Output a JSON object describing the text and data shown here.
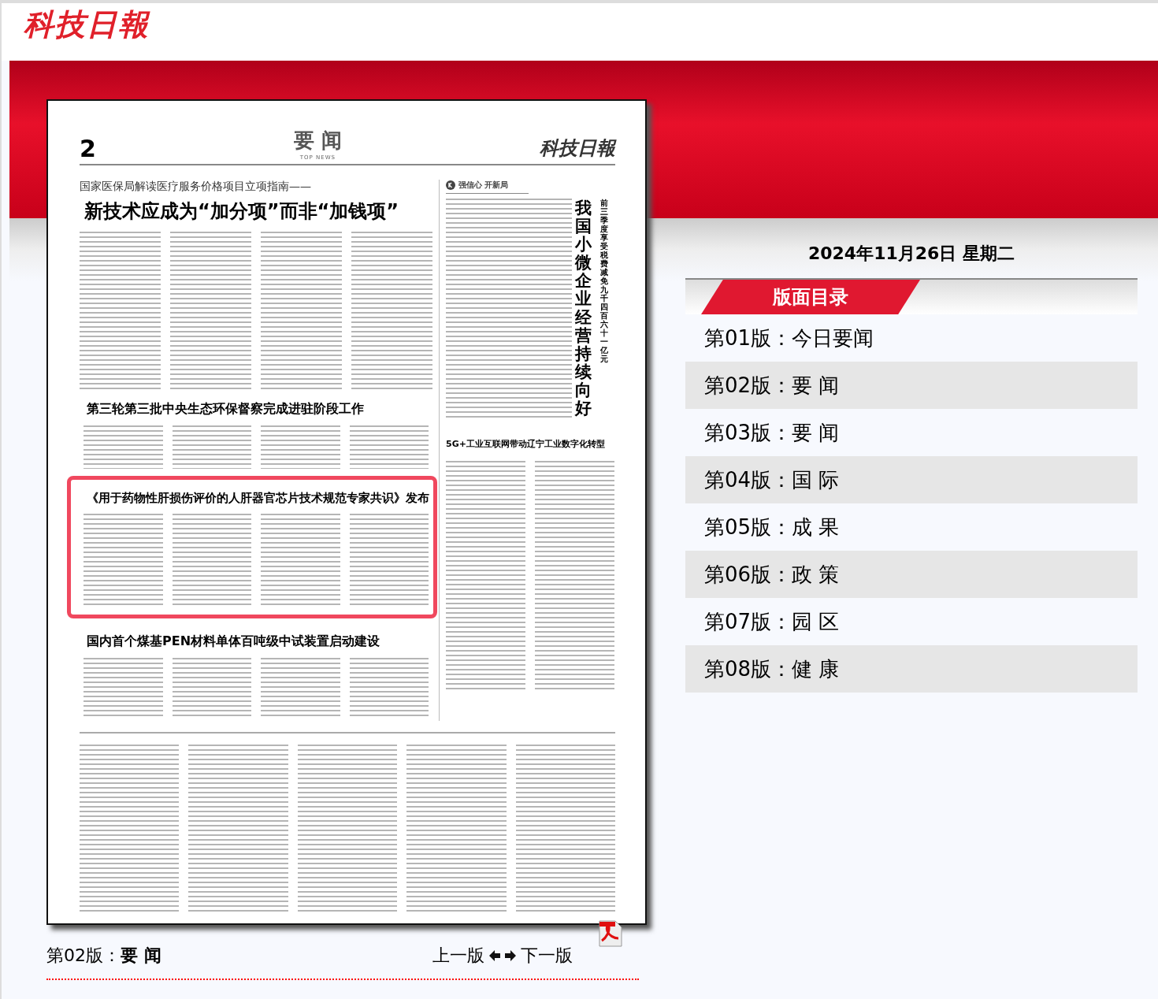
{
  "site_logo": "科技日報",
  "newspaper_page": {
    "page_number": "2",
    "section": "要 闻",
    "section_en": "TOP NEWS",
    "masthead": "科技日報",
    "lead": {
      "kicker": "国家医保局解读医疗服务价格项目立项指南——",
      "title": "新技术应成为“加分项”而非“加钱项”"
    },
    "stories": [
      {
        "title": "第三轮第三批中央生态环保督察完成进驻阶段工作",
        "selected": false
      },
      {
        "title": "《用于药物性肝损伤评价的人肝器官芯片技术规范专家共识》发布",
        "selected": true
      },
      {
        "title": "国内首个煤基PEN材料单体百吨级中试装置启动建设",
        "selected": false
      }
    ],
    "side": {
      "column_label": "强信心 开新局",
      "title": "我国小微企业经营持续向好",
      "kicker": "前三季度享受税费减免九千四百六十一亿元"
    },
    "side_story": {
      "title": "5G+工业互联网带动辽宁工业数字化转型"
    }
  },
  "current_page": "第02版：**要 闻**",
  "prev_link": "上一版",
  "next_link": "下一版",
  "date": "2024年11月26日 星期二",
  "toc": {
    "title": "版面目录",
    "items": [
      {
        "label": "第01版：今日要闻"
      },
      {
        "label": "第02版：要 闻"
      },
      {
        "label": "第03版：要 闻"
      },
      {
        "label": "第04版：国 际"
      },
      {
        "label": "第05版：成 果"
      },
      {
        "label": "第06版：政 策"
      },
      {
        "label": "第07版：园 区"
      },
      {
        "label": "第08版：健 康"
      }
    ]
  }
}
